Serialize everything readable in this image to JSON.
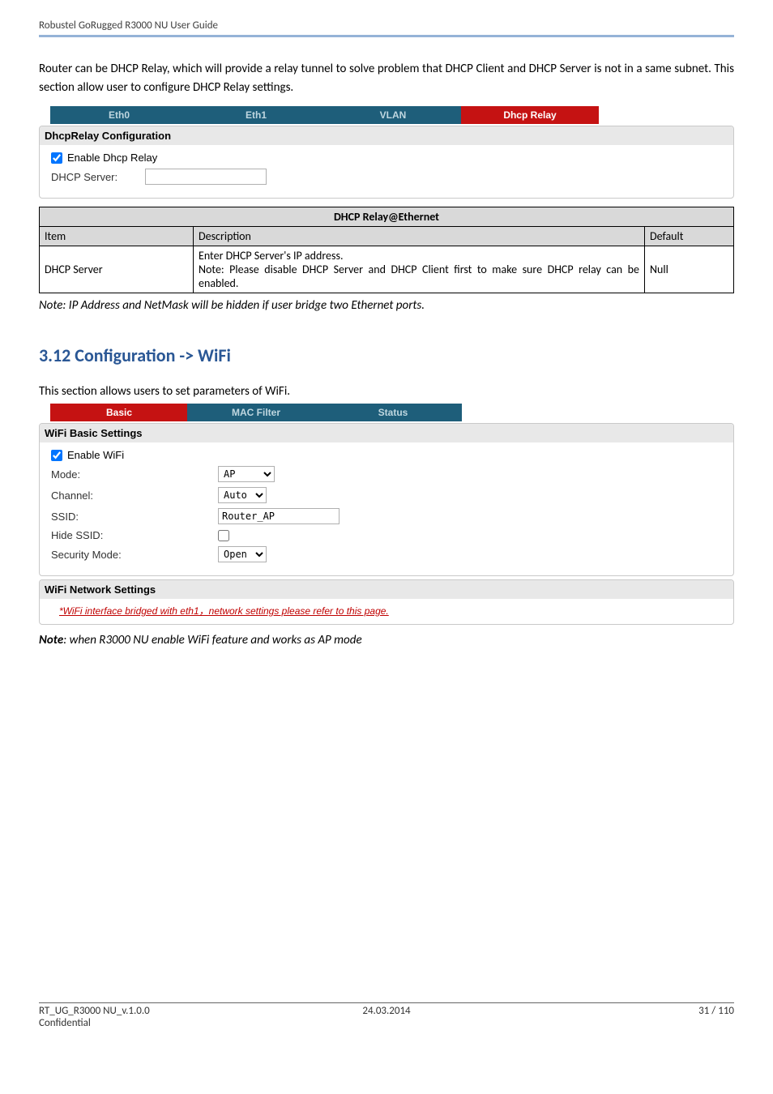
{
  "header": {
    "title": "Robustel GoRugged R3000 NU User Guide"
  },
  "intro_text": "Router can be DHCP Relay, which will provide a relay tunnel to solve problem that DHCP Client and DHCP Server is not in a same subnet. This section allow user to configure DHCP Relay settings.",
  "relay_tabs": {
    "eth0": "Eth0",
    "eth1": "Eth1",
    "vlan": "VLAN",
    "dhcp_relay": "Dhcp Relay"
  },
  "relay_panel": {
    "head": "DhcpRelay Configuration",
    "enable_label": "Enable Dhcp Relay",
    "server_label": "DHCP Server:"
  },
  "relay_table": {
    "title": "DHCP Relay@Ethernet",
    "col_item": "Item",
    "col_desc": "Description",
    "col_default": "Default",
    "row_item": "DHCP Server",
    "row_desc": "Enter DHCP Server's IP address.\nNote: Please disable DHCP Server and DHCP Client first to make sure DHCP relay can be enabled.",
    "row_default": "Null"
  },
  "note1": "Note: IP Address and NetMask will be hidden if user bridge two Ethernet ports.",
  "section_heading": "3.12  Configuration -> WiFi",
  "wifi_intro": "This section allows users to set parameters of WiFi.",
  "wifi_tabs": {
    "basic": "Basic",
    "mac_filter": "MAC Filter",
    "status": "Status"
  },
  "wifi_basic": {
    "head": "WiFi Basic Settings",
    "enable_label": "Enable WiFi",
    "mode_label": "Mode:",
    "mode_value": "AP",
    "channel_label": "Channel:",
    "channel_value": "Auto",
    "ssid_label": "SSID:",
    "ssid_value": "Router_AP",
    "hide_label": "Hide SSID:",
    "security_label": "Security Mode:",
    "security_value": "Open"
  },
  "wifi_network": {
    "head": "WiFi Network Settings",
    "link_text": "*WiFi interface bridged with eth1，network settings please refer to this page."
  },
  "note2_prefix": "Note",
  "note2_rest": ": when R3000 NU enable WiFi feature and works as AP mode",
  "footer": {
    "left_line1": "RT_UG_R3000 NU_v.1.0.0",
    "left_line2": "Confidential",
    "center": "24.03.2014",
    "right": "31 / 110"
  }
}
